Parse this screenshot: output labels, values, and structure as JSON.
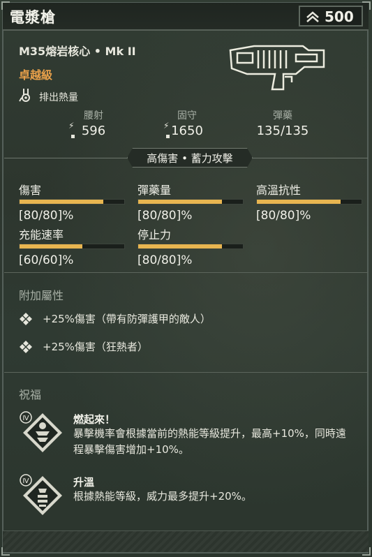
{
  "header": {
    "title": "電漿槍",
    "price": "500",
    "price_icon": "rank-chevron-icon"
  },
  "weapon": {
    "name": "M35熔岩核心 • Mk II",
    "rarity": "卓越級",
    "rarity_color": "#e8a04a",
    "trait_icon": "vent-heat-icon",
    "trait": "排出熱量",
    "image_icon": "plasma-gun-icon"
  },
  "stats": [
    {
      "label": "腰射",
      "value": "596"
    },
    {
      "label": "固守",
      "value": "1650"
    },
    {
      "label": "彈藥",
      "value": "135/135"
    }
  ],
  "fire_mode": "高傷害 • 蓄力攻擊",
  "modifiers": [
    {
      "label": "傷害",
      "value": "[80/80]%",
      "fill": 0.8
    },
    {
      "label": "彈藥量",
      "value": "[80/80]%",
      "fill": 0.8
    },
    {
      "label": "高溫抗性",
      "value": "[80/80]%",
      "fill": 0.8
    },
    {
      "label": "充能速率",
      "value": "[60/60]%",
      "fill": 0.6
    },
    {
      "label": "停止力",
      "value": "[80/80]%",
      "fill": 0.8
    }
  ],
  "perks_section": {
    "title": "附加屬性",
    "items": [
      "+25%傷害（帶有防彈護甲的敵人）",
      "+25%傷害（狂熱者）"
    ]
  },
  "blessings_section": {
    "title": "祝福",
    "items": [
      {
        "tier": "Ⅳ",
        "icon": "blaze-blessing-icon",
        "name": "燃起來！",
        "desc": "暴擊機率會根據當前的熱能等級提升，最高+10%，同時遠程暴擊傷害增加+10%。"
      },
      {
        "tier": "Ⅳ",
        "icon": "heat-up-blessing-icon",
        "name": "升溫",
        "desc": "根據熱能等級，威力最多提升+20%。"
      }
    ]
  },
  "accent_color": "#e8b550"
}
